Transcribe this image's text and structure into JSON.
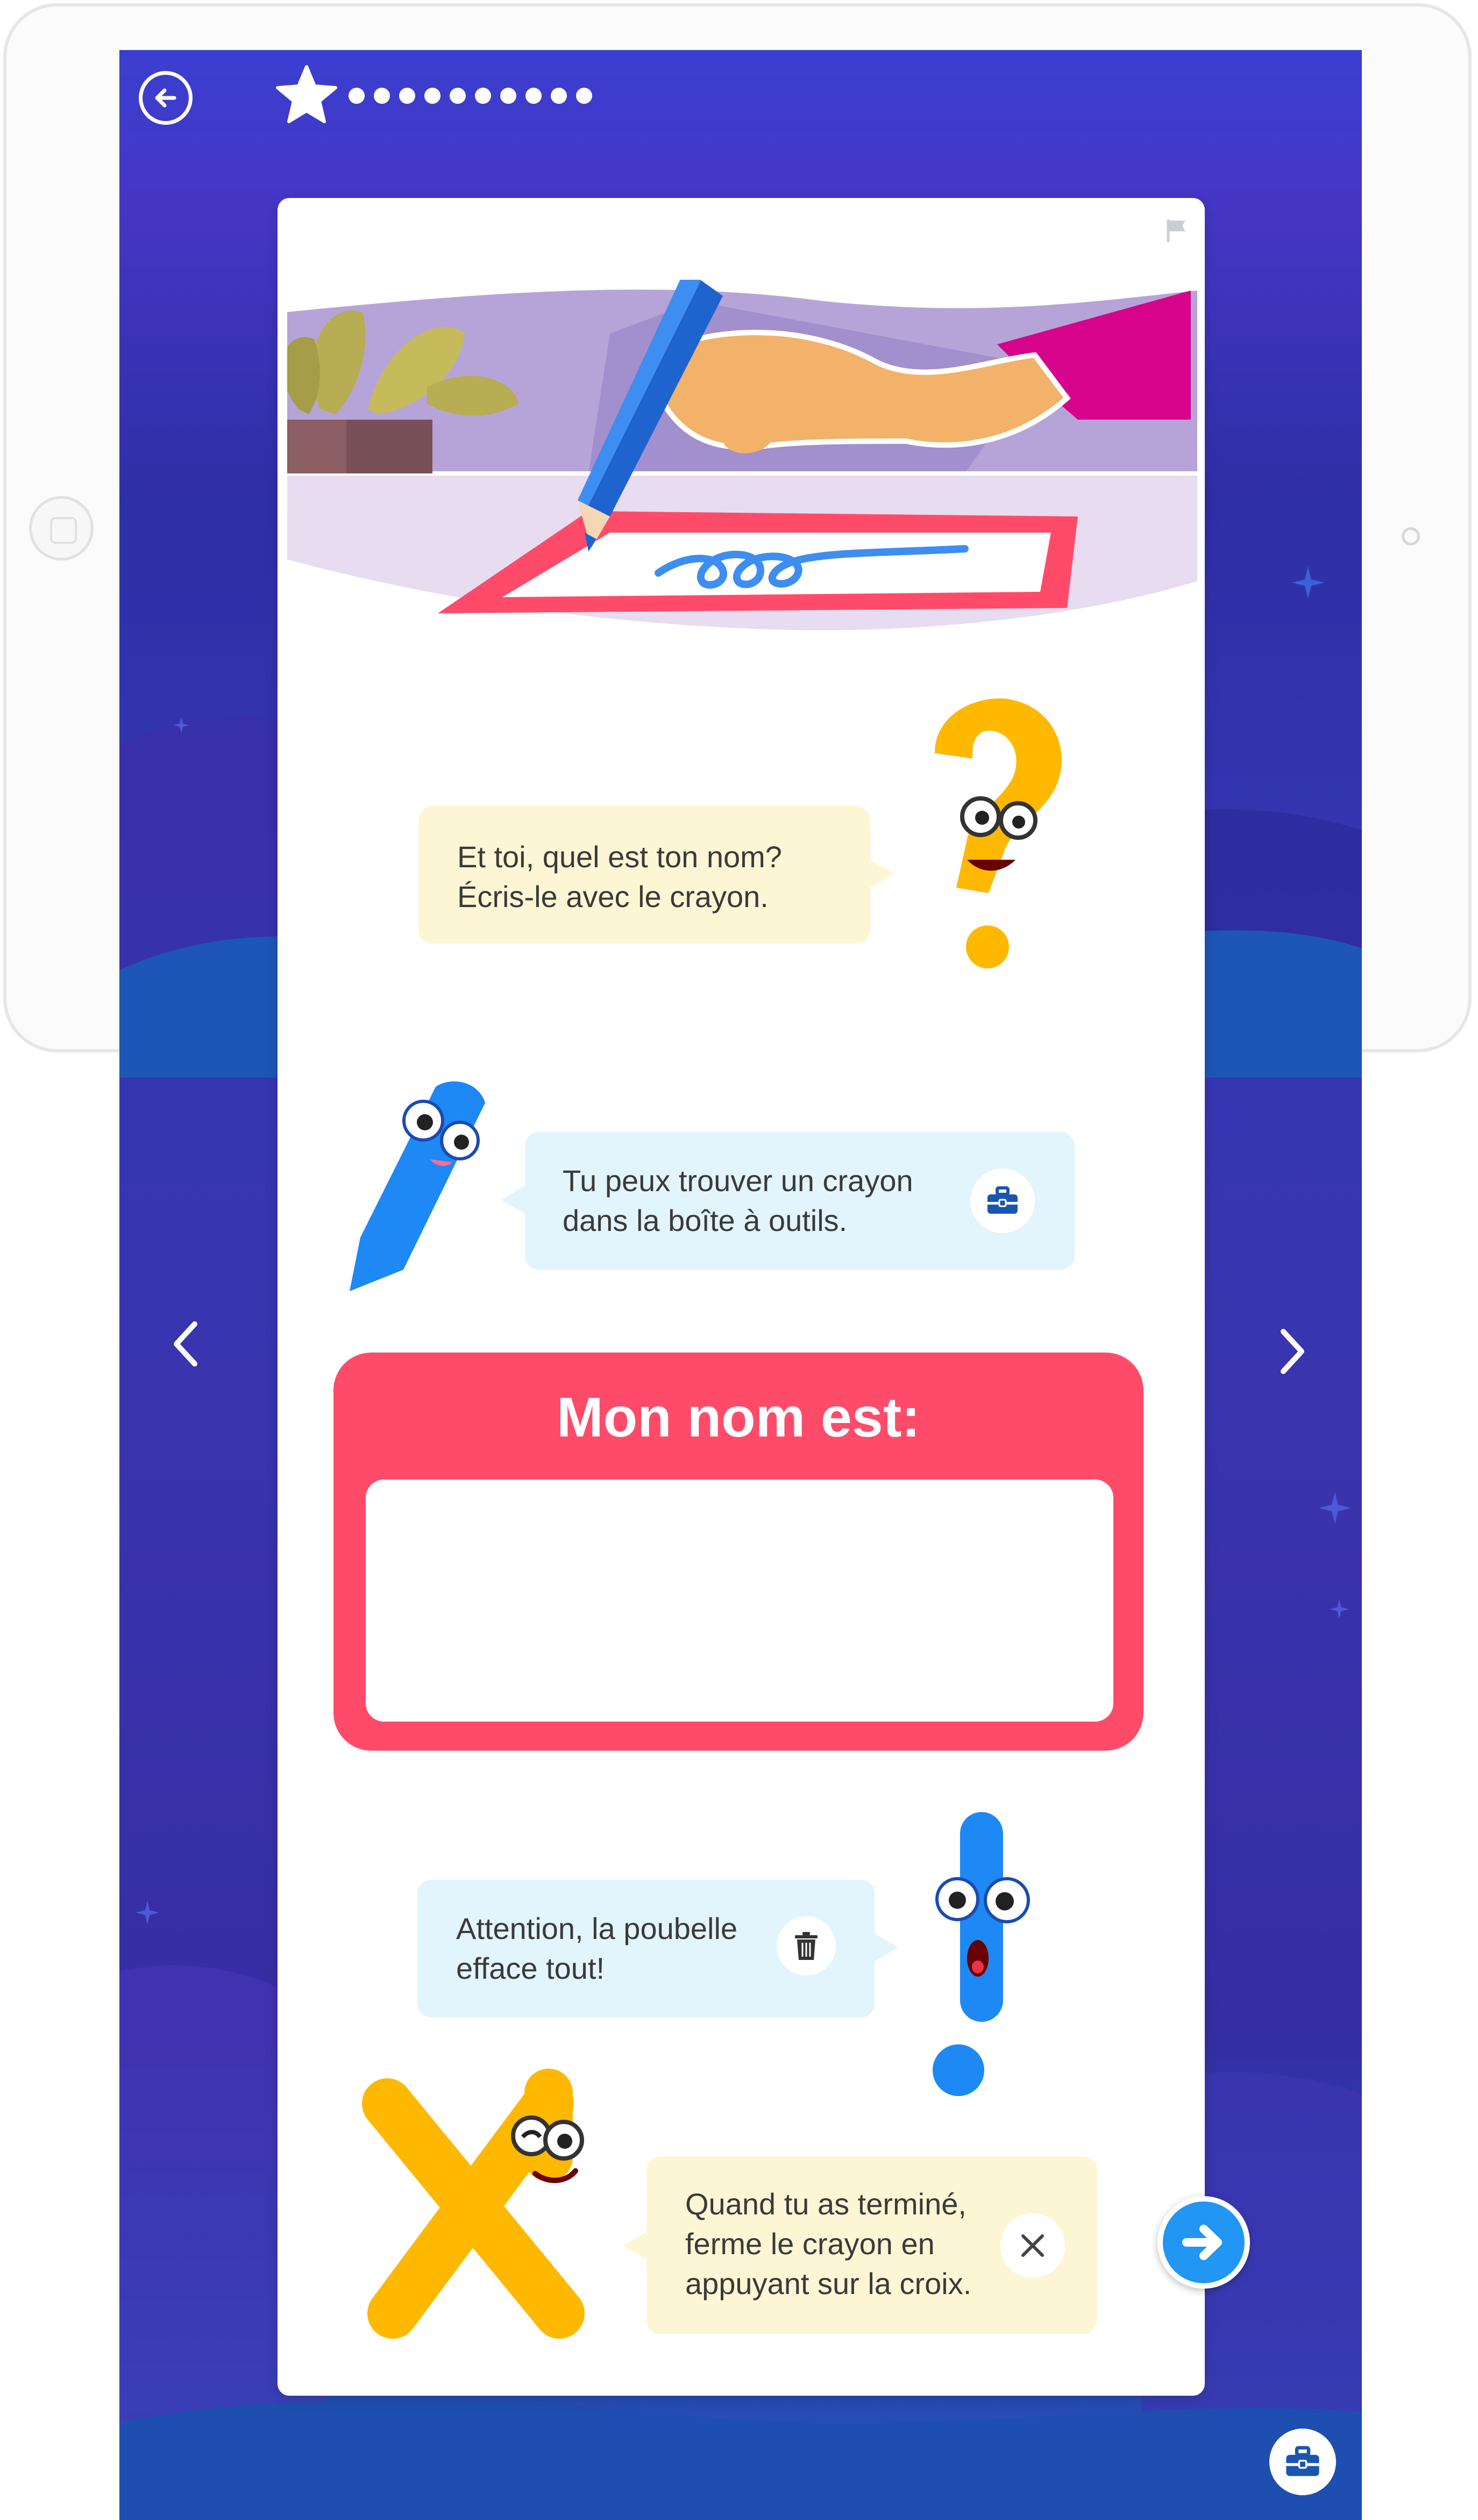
{
  "colors": {
    "background_top": "#3a3fcf",
    "background_bottom": "#2155b8",
    "card": "#ffffff",
    "name_box": "#ff4b6a",
    "bubble_yellow": "#fdf6d4",
    "bubble_blue": "#e2f4fc",
    "accent_blue": "#2196f3",
    "character_yellow": "#ffb800",
    "character_blue": "#1e88f5"
  },
  "progress": {
    "completed": 1,
    "total": 11
  },
  "header": {
    "back_icon": "arrow-left-circle-icon",
    "star_icon": "star-icon",
    "flag_icon": "flag-icon"
  },
  "bubbles": {
    "name_prompt": {
      "line1": "Et toi, quel est ton nom?",
      "line2": "Écris-le avec le crayon."
    },
    "pencil_tip": {
      "line1": "Tu peux trouver un crayon",
      "line2": "dans la boîte à outils.",
      "icon": "toolbox-icon"
    },
    "trash_warning": {
      "line1": "Attention, la poubelle",
      "line2": "efface tout!",
      "icon": "trash-icon"
    },
    "close_tip": {
      "line1": "Quand tu as terminé,",
      "line2": "ferme le crayon en",
      "line3": "appuyant sur la croix.",
      "icon": "close-icon"
    }
  },
  "name_box": {
    "title": "Mon nom est:",
    "value": ""
  },
  "navigation": {
    "prev_icon": "chevron-left-icon",
    "next_icon": "chevron-right-icon",
    "continue_icon": "arrow-right-icon",
    "toolbox_icon": "toolbox-icon"
  }
}
